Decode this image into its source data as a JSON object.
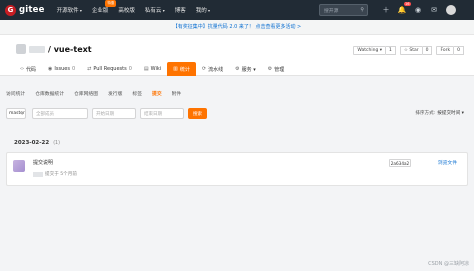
{
  "topnav": {
    "logo_letter": "G",
    "logo_text": "gitee",
    "items": [
      {
        "label": "开源软件",
        "caret": true
      },
      {
        "label": "企业版",
        "badge": "特惠",
        "caret": false
      },
      {
        "label": "高校版",
        "caret": false
      },
      {
        "label": "私有云",
        "caret": true
      },
      {
        "label": "博客",
        "caret": false
      },
      {
        "label": "我的",
        "caret": true
      }
    ],
    "search_placeholder": "搜开源",
    "notifications_count": "16"
  },
  "notice": "【有奖征集中】抗量代码 2.0 来了！ 点击查看更多活动 >",
  "repo": {
    "name": "/ vue-text",
    "watch_label": "Watching ▾",
    "watch_count": "1",
    "star_label": "☆ Star",
    "star_count": "0",
    "fork_label": "Fork",
    "fork_count": "0",
    "tabs": [
      {
        "icon": "‹›",
        "label": "代码",
        "count": ""
      },
      {
        "icon": "◉",
        "label": "Issues",
        "count": "0"
      },
      {
        "icon": "⇄",
        "label": "Pull Requests",
        "count": "0"
      },
      {
        "icon": "▤",
        "label": "Wiki",
        "count": ""
      },
      {
        "icon": "▥",
        "label": "统计",
        "count": ""
      },
      {
        "icon": "⟳",
        "label": "流水线",
        "count": ""
      },
      {
        "icon": "⚙",
        "label": "服务 ▾",
        "count": ""
      },
      {
        "icon": "⚙",
        "label": "管理",
        "count": ""
      }
    ]
  },
  "subnav": [
    "访问统计",
    "仓库数据统计",
    "仓库网络图",
    "发行版",
    "标签",
    "提交",
    "附件"
  ],
  "filters": {
    "branch": "master",
    "author_placeholder": "全部成员",
    "start_placeholder": "开始日期",
    "end_placeholder": "结束日期",
    "search_btn": "搜索",
    "sort_label": "排序方式:",
    "sort_value": "按提交时间 ▾"
  },
  "commits": {
    "date": "2023-02-22",
    "count": "(1)",
    "items": [
      {
        "message": "提交说明",
        "meta": "提交于 5个月前",
        "sha": "2a634a2",
        "browse": "浏览文件"
      }
    ]
  },
  "watermark": "CSDN @三缺阿凉"
}
